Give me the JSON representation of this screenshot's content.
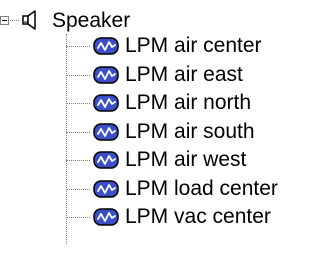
{
  "tree": {
    "root": {
      "label": "Speaker",
      "icon": "speaker-icon",
      "expanded": true
    },
    "children": [
      {
        "label": "LPM air center",
        "icon": "lpm-device-icon"
      },
      {
        "label": "LPM air east",
        "icon": "lpm-device-icon"
      },
      {
        "label": "LPM air north",
        "icon": "lpm-device-icon"
      },
      {
        "label": "LPM air south",
        "icon": "lpm-device-icon"
      },
      {
        "label": "LPM air west",
        "icon": "lpm-device-icon"
      },
      {
        "label": "LPM load center",
        "icon": "lpm-device-icon"
      },
      {
        "label": "LPM vac center",
        "icon": "lpm-device-icon"
      }
    ]
  }
}
